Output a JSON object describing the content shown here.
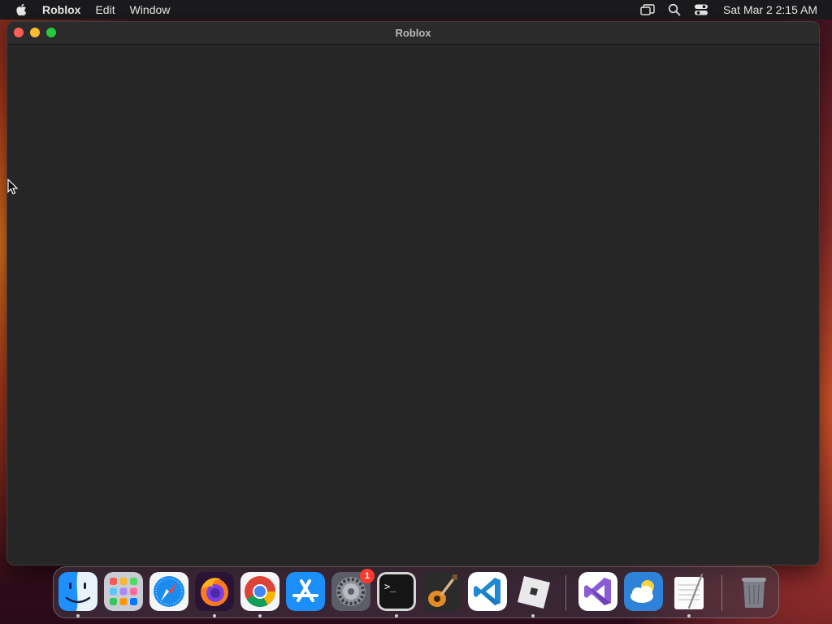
{
  "menubar": {
    "app_name": "Roblox",
    "items": [
      "Edit",
      "Window"
    ],
    "clock": "Sat Mar 2  2:15 AM"
  },
  "window": {
    "title": "Roblox"
  },
  "dock": {
    "items": [
      {
        "name": "Finder",
        "icon": "finder-icon",
        "running": true
      },
      {
        "name": "Launchpad",
        "icon": "launchpad-icon",
        "running": false
      },
      {
        "name": "Safari",
        "icon": "safari-icon",
        "running": false
      },
      {
        "name": "Firefox",
        "icon": "firefox-icon",
        "running": true
      },
      {
        "name": "Google Chrome",
        "icon": "chrome-icon",
        "running": true
      },
      {
        "name": "App Store",
        "icon": "app-store-icon",
        "running": false
      },
      {
        "name": "System Settings",
        "icon": "system-settings-icon",
        "running": false,
        "badge": "1"
      },
      {
        "name": "Terminal",
        "icon": "terminal-icon",
        "running": true
      },
      {
        "name": "GarageBand",
        "icon": "garageband-icon",
        "running": false
      },
      {
        "name": "Visual Studio Code",
        "icon": "vscode-icon",
        "running": false
      },
      {
        "name": "Roblox",
        "icon": "roblox-icon",
        "running": true
      },
      {
        "name": "Visual Studio",
        "icon": "visual-studio-icon",
        "running": false
      },
      {
        "name": "Weather",
        "icon": "weather-icon",
        "running": false
      },
      {
        "name": "TextEdit",
        "icon": "textedit-icon",
        "running": true
      },
      {
        "name": "Trash",
        "icon": "trash-icon",
        "running": false
      }
    ]
  },
  "colors": {
    "menubar_bg": "#1b1b1d",
    "window_bg": "#262626",
    "close": "#ff5f57",
    "minimize": "#febc2e",
    "maximize": "#28c840",
    "badge": "#ff3b30"
  }
}
